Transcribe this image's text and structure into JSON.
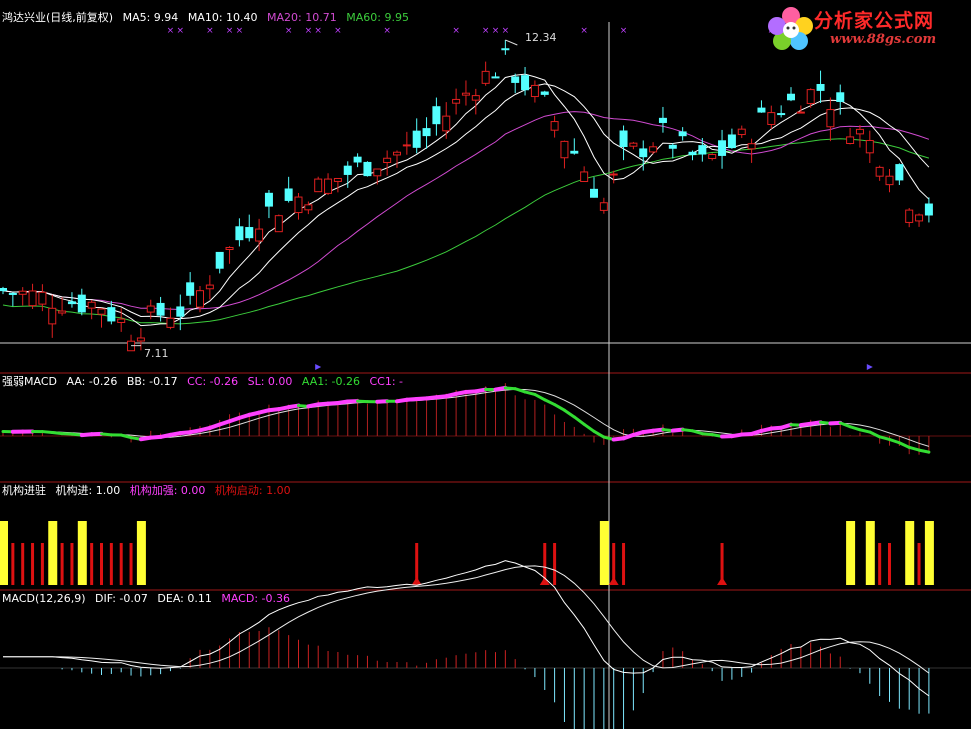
{
  "colors": {
    "bg": "#000000",
    "up": "#e02020",
    "down": "#54ffff",
    "border": "#b01818",
    "ma5": "#ffffff",
    "ma10": "#ffffff",
    "ma20": "#d14bd1",
    "ma60": "#3ccc3c",
    "white": "#ffffff",
    "magenta": "#ff40ff",
    "green": "#33dd33",
    "yellow": "#ffff33",
    "red": "#dd1111"
  },
  "watermark": {
    "title": "分析家公式网",
    "url": "www.88gs.com"
  },
  "panel1": {
    "title": "鸿达兴业(日线,前复权)",
    "legend": [
      {
        "label": "MA5: 9.94",
        "color": "#ffffff"
      },
      {
        "label": "MA10: 10.40",
        "color": "#ffffff"
      },
      {
        "label": "MA20: 10.71",
        "color": "#d14bd1"
      },
      {
        "label": "MA60: 9.95",
        "color": "#3ccc3c"
      }
    ],
    "high_label": "12.34",
    "low_label": "7.11",
    "marks": "×"
  },
  "panel2": {
    "title": "强弱MACD",
    "legend": [
      {
        "label": "AA: -0.26",
        "color": "#ffffff"
      },
      {
        "label": "BB: -0.17",
        "color": "#ffffff"
      },
      {
        "label": "CC: -0.26",
        "color": "#ff40ff"
      },
      {
        "label": "SL: 0.00",
        "color": "#ff40ff"
      },
      {
        "label": "AA1: -0.26",
        "color": "#33dd33"
      },
      {
        "label": "CC1: -",
        "color": "#ff40ff"
      }
    ]
  },
  "panel3": {
    "title": "机构进驻",
    "legend": [
      {
        "label": "机构进: 1.00",
        "color": "#ffffff"
      },
      {
        "label": "机构加强: 0.00",
        "color": "#ff40ff"
      },
      {
        "label": "机构启动: 1.00",
        "color": "#dd1111"
      }
    ]
  },
  "panel4": {
    "title": "MACD(12,26,9)",
    "legend": [
      {
        "label": "DIF: -0.07",
        "color": "#ffffff"
      },
      {
        "label": "DEA: 0.11",
        "color": "#ffffff"
      },
      {
        "label": "MACD: -0.36",
        "color": "#ff40ff"
      }
    ]
  },
  "chart_data": {
    "type": "candlestick",
    "price_ylim": [
      7.0,
      12.6
    ],
    "n_bars": 95,
    "anchors": [
      [
        0,
        8.0
      ],
      [
        5,
        7.85
      ],
      [
        10,
        7.75
      ],
      [
        13,
        7.3
      ],
      [
        16,
        7.6
      ],
      [
        19,
        7.7
      ],
      [
        22,
        8.5
      ],
      [
        26,
        9.3
      ],
      [
        31,
        9.7
      ],
      [
        37,
        10.2
      ],
      [
        42,
        10.5
      ],
      [
        48,
        11.6
      ],
      [
        51,
        11.95
      ],
      [
        55,
        11.2
      ],
      [
        58,
        10.4
      ],
      [
        61,
        9.5
      ],
      [
        63,
        10.3
      ],
      [
        67,
        10.7
      ],
      [
        71,
        10.2
      ],
      [
        75,
        10.6
      ],
      [
        78,
        11.1
      ],
      [
        83,
        11.5
      ],
      [
        86,
        10.9
      ],
      [
        90,
        10.2
      ],
      [
        92,
        9.6
      ],
      [
        94,
        9.4
      ]
    ],
    "high": 12.34,
    "low": 7.11
  }
}
